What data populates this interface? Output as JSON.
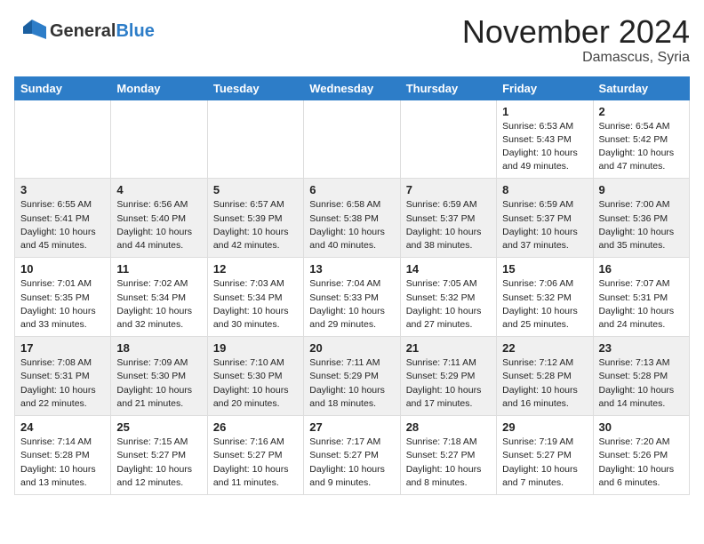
{
  "header": {
    "logo_general": "General",
    "logo_blue": "Blue",
    "month_title": "November 2024",
    "location": "Damascus, Syria"
  },
  "days_of_week": [
    "Sunday",
    "Monday",
    "Tuesday",
    "Wednesday",
    "Thursday",
    "Friday",
    "Saturday"
  ],
  "weeks": [
    [
      {
        "day": "",
        "content": ""
      },
      {
        "day": "",
        "content": ""
      },
      {
        "day": "",
        "content": ""
      },
      {
        "day": "",
        "content": ""
      },
      {
        "day": "",
        "content": ""
      },
      {
        "day": "1",
        "content": "Sunrise: 6:53 AM\nSunset: 5:43 PM\nDaylight: 10 hours\nand 49 minutes."
      },
      {
        "day": "2",
        "content": "Sunrise: 6:54 AM\nSunset: 5:42 PM\nDaylight: 10 hours\nand 47 minutes."
      }
    ],
    [
      {
        "day": "3",
        "content": "Sunrise: 6:55 AM\nSunset: 5:41 PM\nDaylight: 10 hours\nand 45 minutes."
      },
      {
        "day": "4",
        "content": "Sunrise: 6:56 AM\nSunset: 5:40 PM\nDaylight: 10 hours\nand 44 minutes."
      },
      {
        "day": "5",
        "content": "Sunrise: 6:57 AM\nSunset: 5:39 PM\nDaylight: 10 hours\nand 42 minutes."
      },
      {
        "day": "6",
        "content": "Sunrise: 6:58 AM\nSunset: 5:38 PM\nDaylight: 10 hours\nand 40 minutes."
      },
      {
        "day": "7",
        "content": "Sunrise: 6:59 AM\nSunset: 5:37 PM\nDaylight: 10 hours\nand 38 minutes."
      },
      {
        "day": "8",
        "content": "Sunrise: 6:59 AM\nSunset: 5:37 PM\nDaylight: 10 hours\nand 37 minutes."
      },
      {
        "day": "9",
        "content": "Sunrise: 7:00 AM\nSunset: 5:36 PM\nDaylight: 10 hours\nand 35 minutes."
      }
    ],
    [
      {
        "day": "10",
        "content": "Sunrise: 7:01 AM\nSunset: 5:35 PM\nDaylight: 10 hours\nand 33 minutes."
      },
      {
        "day": "11",
        "content": "Sunrise: 7:02 AM\nSunset: 5:34 PM\nDaylight: 10 hours\nand 32 minutes."
      },
      {
        "day": "12",
        "content": "Sunrise: 7:03 AM\nSunset: 5:34 PM\nDaylight: 10 hours\nand 30 minutes."
      },
      {
        "day": "13",
        "content": "Sunrise: 7:04 AM\nSunset: 5:33 PM\nDaylight: 10 hours\nand 29 minutes."
      },
      {
        "day": "14",
        "content": "Sunrise: 7:05 AM\nSunset: 5:32 PM\nDaylight: 10 hours\nand 27 minutes."
      },
      {
        "day": "15",
        "content": "Sunrise: 7:06 AM\nSunset: 5:32 PM\nDaylight: 10 hours\nand 25 minutes."
      },
      {
        "day": "16",
        "content": "Sunrise: 7:07 AM\nSunset: 5:31 PM\nDaylight: 10 hours\nand 24 minutes."
      }
    ],
    [
      {
        "day": "17",
        "content": "Sunrise: 7:08 AM\nSunset: 5:31 PM\nDaylight: 10 hours\nand 22 minutes."
      },
      {
        "day": "18",
        "content": "Sunrise: 7:09 AM\nSunset: 5:30 PM\nDaylight: 10 hours\nand 21 minutes."
      },
      {
        "day": "19",
        "content": "Sunrise: 7:10 AM\nSunset: 5:30 PM\nDaylight: 10 hours\nand 20 minutes."
      },
      {
        "day": "20",
        "content": "Sunrise: 7:11 AM\nSunset: 5:29 PM\nDaylight: 10 hours\nand 18 minutes."
      },
      {
        "day": "21",
        "content": "Sunrise: 7:11 AM\nSunset: 5:29 PM\nDaylight: 10 hours\nand 17 minutes."
      },
      {
        "day": "22",
        "content": "Sunrise: 7:12 AM\nSunset: 5:28 PM\nDaylight: 10 hours\nand 16 minutes."
      },
      {
        "day": "23",
        "content": "Sunrise: 7:13 AM\nSunset: 5:28 PM\nDaylight: 10 hours\nand 14 minutes."
      }
    ],
    [
      {
        "day": "24",
        "content": "Sunrise: 7:14 AM\nSunset: 5:28 PM\nDaylight: 10 hours\nand 13 minutes."
      },
      {
        "day": "25",
        "content": "Sunrise: 7:15 AM\nSunset: 5:27 PM\nDaylight: 10 hours\nand 12 minutes."
      },
      {
        "day": "26",
        "content": "Sunrise: 7:16 AM\nSunset: 5:27 PM\nDaylight: 10 hours\nand 11 minutes."
      },
      {
        "day": "27",
        "content": "Sunrise: 7:17 AM\nSunset: 5:27 PM\nDaylight: 10 hours\nand 9 minutes."
      },
      {
        "day": "28",
        "content": "Sunrise: 7:18 AM\nSunset: 5:27 PM\nDaylight: 10 hours\nand 8 minutes."
      },
      {
        "day": "29",
        "content": "Sunrise: 7:19 AM\nSunset: 5:27 PM\nDaylight: 10 hours\nand 7 minutes."
      },
      {
        "day": "30",
        "content": "Sunrise: 7:20 AM\nSunset: 5:26 PM\nDaylight: 10 hours\nand 6 minutes."
      }
    ]
  ]
}
